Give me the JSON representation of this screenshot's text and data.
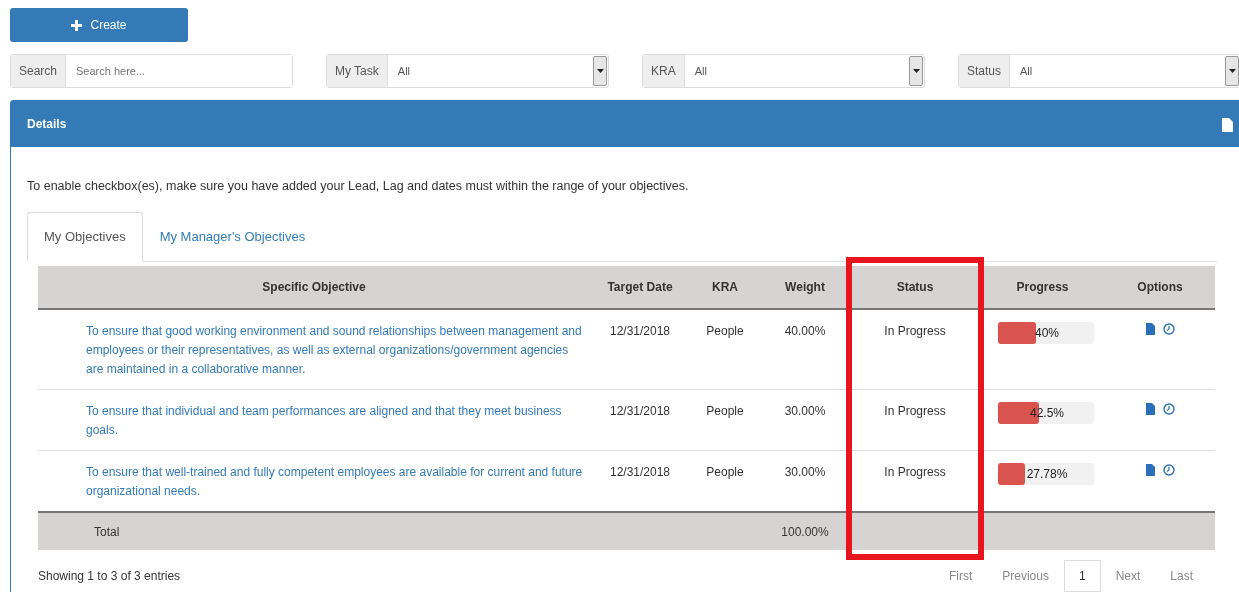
{
  "create_button": {
    "label": "Create"
  },
  "filters": [
    {
      "kind": "search",
      "label": "Search",
      "placeholder": "Search here..."
    },
    {
      "kind": "select",
      "label": "My Task",
      "value": "All"
    },
    {
      "kind": "select",
      "label": "KRA",
      "value": "All"
    },
    {
      "kind": "select",
      "label": "Status",
      "value": "All"
    }
  ],
  "panel": {
    "title": "Details",
    "note": "To enable checkbox(es), make sure you have added your Lead, Lag and dates must within the range of your objectives."
  },
  "tabs": [
    {
      "label": "My Objectives",
      "selected": true
    },
    {
      "label": "My Manager's Objectives",
      "selected": false
    }
  ],
  "table": {
    "columns": [
      {
        "label": "Specific Objective",
        "highlighted": false
      },
      {
        "label": "Target Date",
        "highlighted": false
      },
      {
        "label": "KRA",
        "highlighted": false
      },
      {
        "label": "Weight",
        "highlighted": false
      },
      {
        "label": "Status",
        "highlighted": true
      },
      {
        "label": "Progress",
        "highlighted": false
      },
      {
        "label": "Options",
        "highlighted": false
      }
    ],
    "rows": [
      {
        "objective": "To ensure that good working environment and sound relationships between management and employees or their representatives, as well as external organizations/government agencies are maintained in a collaborative manner.",
        "target_date": "12/31/2018",
        "kra": "People",
        "weight": "40.00%",
        "status": "In Progress",
        "progress": {
          "level": 0.4,
          "label": "40%"
        }
      },
      {
        "objective": "To ensure that individual and team performances are aligned and that they meet business goals.",
        "target_date": "12/31/2018",
        "kra": "People",
        "weight": "30.00%",
        "status": "In Progress",
        "progress": {
          "level": 0.425,
          "label": "42.5%"
        }
      },
      {
        "objective": "To ensure that well-trained and fully competent employees are available for current and future organizational needs.",
        "target_date": "12/31/2018",
        "kra": "People",
        "weight": "30.00%",
        "status": "In Progress",
        "progress": {
          "level": 0.2778,
          "label": "27.78%"
        }
      }
    ],
    "total": {
      "label": "Total",
      "weight": "100.00%"
    }
  },
  "footer": {
    "info": "Showing 1 to 3 of 3 entries",
    "pager": [
      {
        "label": "First",
        "selected": false
      },
      {
        "label": "Previous",
        "selected": false
      },
      {
        "label": "1",
        "selected": true
      },
      {
        "label": "Next",
        "selected": false
      },
      {
        "label": "Last",
        "selected": false
      }
    ]
  }
}
